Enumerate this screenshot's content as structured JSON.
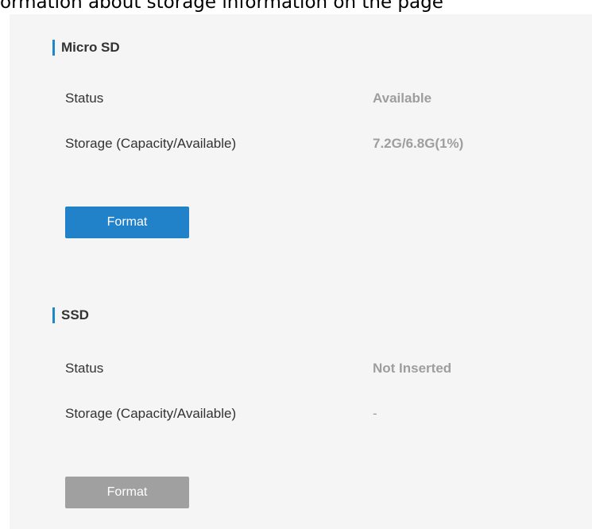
{
  "caption": "ormation about storage information on the page",
  "sections": [
    {
      "title": "Micro SD",
      "rows": [
        {
          "label": "Status",
          "value": "Available"
        },
        {
          "label": "Storage (Capacity/Available)",
          "value": "7.2G/6.8G(1%)"
        }
      ],
      "button": {
        "label": "Format",
        "enabled": true
      }
    },
    {
      "title": "SSD",
      "rows": [
        {
          "label": "Status",
          "value": "Not Inserted"
        },
        {
          "label": "Storage (Capacity/Available)",
          "value": "-"
        }
      ],
      "button": {
        "label": "Format",
        "enabled": false
      }
    }
  ],
  "colors": {
    "accent": "#1e88c9",
    "button_primary": "#2181c9",
    "button_disabled": "#a0a0a0",
    "value_text": "#9e9e9e",
    "panel_bg": "#f5f5f5"
  }
}
